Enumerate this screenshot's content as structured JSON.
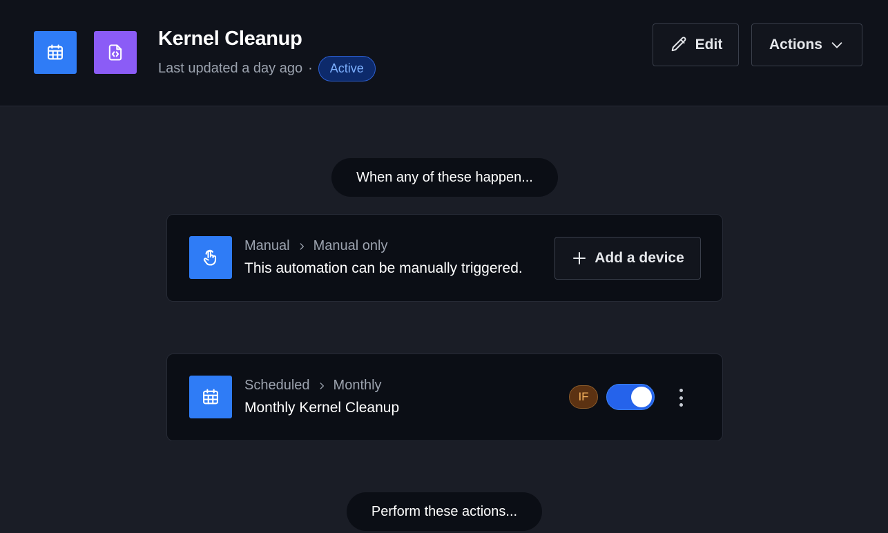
{
  "header": {
    "title": "Kernel Cleanup",
    "last_updated": "Last updated a day ago",
    "separator": "·",
    "status": "Active",
    "edit_label": "Edit",
    "actions_label": "Actions",
    "icons": [
      "calendar-icon",
      "code-file-icon"
    ]
  },
  "flow": {
    "trigger_heading": "When any of these happen...",
    "actions_heading": "Perform these actions..."
  },
  "triggers": [
    {
      "icon": "hand-pointer-icon",
      "category": "Manual",
      "type": "Manual only",
      "description": "This automation can be manually triggered.",
      "button_label": "Add a device"
    },
    {
      "icon": "calendar-icon",
      "category": "Scheduled",
      "type": "Monthly",
      "description": "Monthly Kernel Cleanup",
      "if_label": "IF",
      "enabled": true
    }
  ],
  "colors": {
    "accent_blue": "#2f7cf6",
    "accent_purple": "#8b5cf6",
    "toggle_on": "#2563eb",
    "if_badge": "#5c3212"
  }
}
